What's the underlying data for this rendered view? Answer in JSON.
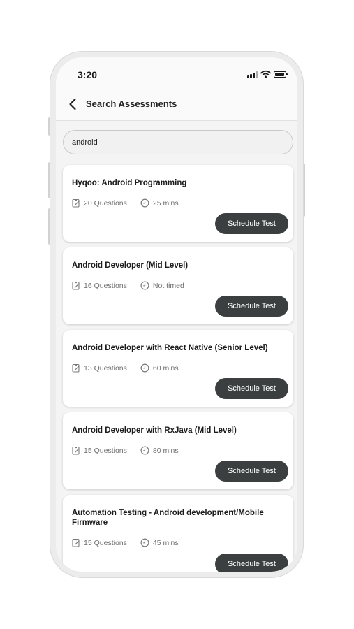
{
  "status_bar": {
    "time": "3:20"
  },
  "header": {
    "title": "Search Assessments",
    "back_icon": "chevron-left-icon"
  },
  "search": {
    "value": "android"
  },
  "results": [
    {
      "title": "Hyqoo: Android Programming",
      "questions": "20 Questions",
      "duration": "25 mins",
      "action": "Schedule Test"
    },
    {
      "title": "Android Developer (Mid Level)",
      "questions": "16 Questions",
      "duration": "Not timed",
      "action": "Schedule Test"
    },
    {
      "title": "Android Developer with React Native (Senior Level)",
      "questions": "13 Questions",
      "duration": "60 mins",
      "action": "Schedule Test"
    },
    {
      "title": "Android Developer with RxJava (Mid Level)",
      "questions": "15 Questions",
      "duration": "80 mins",
      "action": "Schedule Test"
    },
    {
      "title": "Automation Testing - Android development/Mobile Firmware",
      "questions": "15 Questions",
      "duration": "45 mins",
      "action": "Schedule Test"
    }
  ],
  "colors": {
    "button_bg": "#3b3f40",
    "button_text": "#ffffff",
    "card_bg": "#ffffff",
    "screen_bg": "#f4f4f4",
    "meta_text": "#6d6d6d"
  },
  "icons": {
    "questions": "clipboard-icon",
    "duration": "clock-icon"
  }
}
